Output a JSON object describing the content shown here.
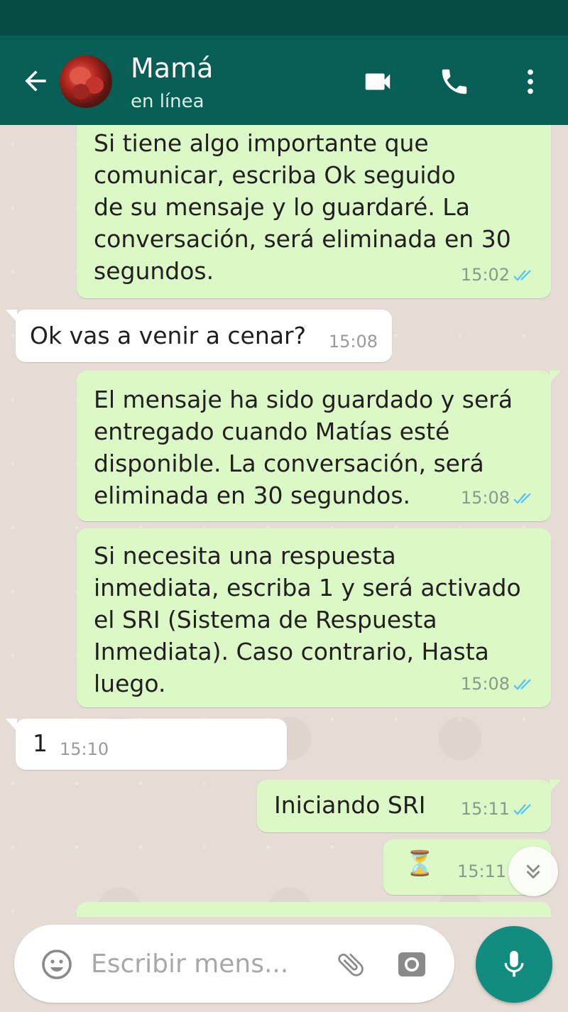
{
  "header": {
    "contact_name": "Mamá",
    "contact_status": "en línea",
    "icons": [
      "back-arrow-icon",
      "video-call-icon",
      "phone-icon",
      "more-vert-icon"
    ]
  },
  "messages": [
    {
      "direction": "out",
      "text": "Si tiene algo importante que\ncomunicar, escriba Ok seguido\nde su mensaje y lo guardaré. La\nconversación, será eliminada en 30\nsegundos.",
      "time": "15:02",
      "status": "read"
    },
    {
      "direction": "in",
      "text": "Ok vas a venir a cenar?",
      "time": "15:08"
    },
    {
      "direction": "out",
      "text": "El mensaje ha sido guardado y será\nentregado cuando Matías esté\ndisponible. La conversación, será\neliminada en 30 segundos.",
      "time": "15:08",
      "status": "read"
    },
    {
      "direction": "out",
      "text": "Si necesita una respuesta\ninmediata, escriba 1 y será activado\nel SRI (Sistema de Respuesta\nInmediata). Caso contrario, Hasta\nluego.",
      "time": "15:08",
      "status": "read"
    },
    {
      "direction": "in",
      "text": "1",
      "time": "15:10"
    },
    {
      "direction": "out",
      "text": "Iniciando SRI",
      "time": "15:11",
      "status": "read"
    },
    {
      "direction": "out",
      "text": "⏳",
      "time": "15:11",
      "status": "read"
    }
  ],
  "composer": {
    "placeholder": "Escribir mens..."
  },
  "colors": {
    "header": "#075e54",
    "statusbar": "#054d44",
    "outgoing_bubble": "#dcf8c6",
    "incoming_bubble": "#ffffff",
    "read_ticks": "#4fc3f7",
    "mic_button": "#128c7e"
  }
}
